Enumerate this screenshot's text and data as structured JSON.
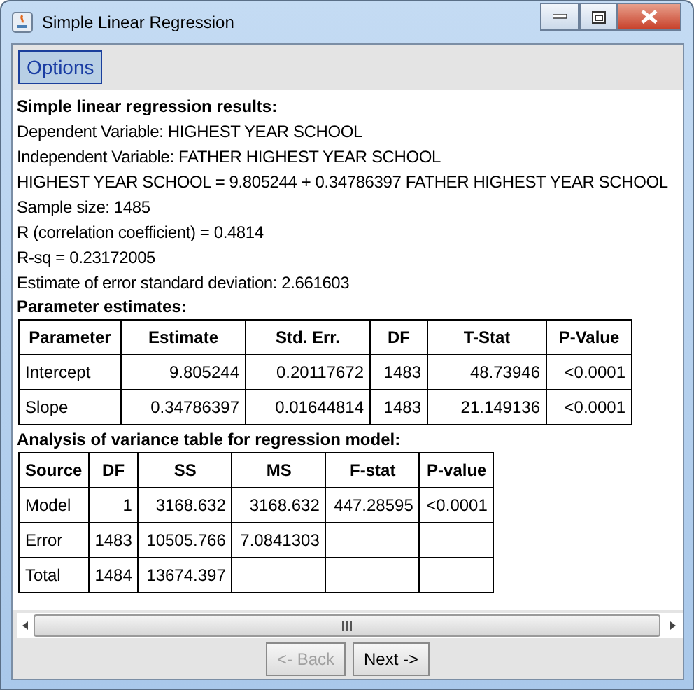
{
  "window": {
    "title": "Simple Linear Regression"
  },
  "menu": [
    {
      "label": "Options",
      "selected": true
    }
  ],
  "results": {
    "heading": "Simple linear regression results:",
    "lines": [
      "Dependent Variable: HIGHEST YEAR SCHOOL",
      "Independent Variable: FATHER HIGHEST YEAR SCHOOL",
      "HIGHEST YEAR SCHOOL = 9.805244 + 0.34786397 FATHER HIGHEST YEAR SCHOOL",
      "Sample size: 1485",
      "R (correlation coefficient) =  0.4814",
      "R-sq = 0.23172005",
      "Estimate of error standard deviation: 2.661603"
    ]
  },
  "tables": [
    {
      "heading": "Parameter estimates:",
      "columns": [
        "Parameter",
        "Estimate",
        "Std. Err.",
        "DF",
        "T-Stat",
        "P-Value"
      ],
      "rows": [
        [
          "Intercept",
          "9.805244",
          "0.20117672",
          "1483",
          "48.73946",
          "<0.0001"
        ],
        [
          "Slope",
          "0.34786397",
          "0.01644814",
          "1483",
          "21.149136",
          "<0.0001"
        ]
      ]
    },
    {
      "heading": "Analysis of variance table for regression model:",
      "columns": [
        "Source",
        "DF",
        "SS",
        "MS",
        "F-stat",
        "P-value"
      ],
      "rows": [
        [
          "Model",
          "1",
          "3168.632",
          "3168.632",
          "447.28595",
          "<0.0001"
        ],
        [
          "Error",
          "1483",
          "10505.766",
          "7.0841303",
          "",
          ""
        ],
        [
          "Total",
          "1484",
          "13674.397",
          "",
          "",
          ""
        ]
      ]
    }
  ],
  "buttons": [
    {
      "label": "<- Back",
      "disabled": true
    },
    {
      "label": "Next ->",
      "disabled": false
    }
  ]
}
